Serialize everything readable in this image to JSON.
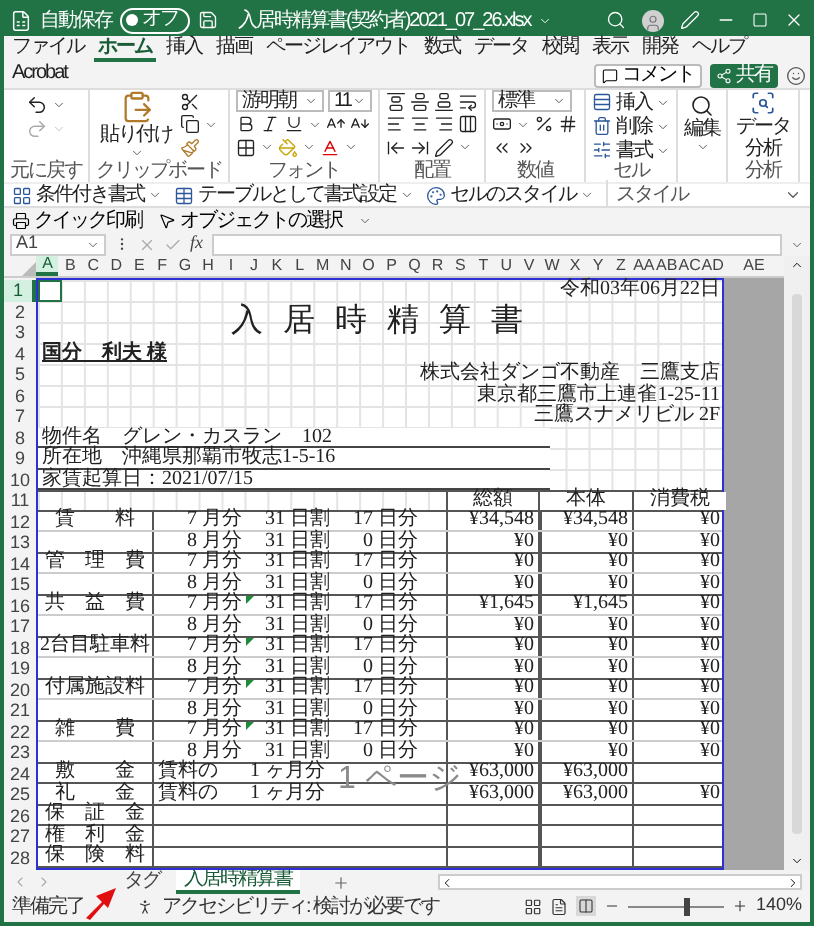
{
  "title_bar": {
    "autosave_label": "自動保存",
    "autosave": {
      "label": "オフ",
      "on": false
    },
    "filename": "入居時精算書(契約者)2021_07_26.xlsx"
  },
  "menu": {
    "tabs": [
      {
        "label": "ファイル",
        "selected": false
      },
      {
        "label": "ホーム",
        "selected": true
      },
      {
        "label": "挿入",
        "selected": false
      },
      {
        "label": "描画",
        "selected": false
      },
      {
        "label": "ページレイアウト",
        "selected": false
      },
      {
        "label": "数式",
        "selected": false
      },
      {
        "label": "データ",
        "selected": false
      },
      {
        "label": "校閲",
        "selected": false
      },
      {
        "label": "表示",
        "selected": false
      },
      {
        "label": "開発",
        "selected": false
      },
      {
        "label": "ヘルプ",
        "selected": false
      },
      {
        "label": "Acrobat",
        "selected": false
      }
    ],
    "comment_button": "コメント",
    "share_button": "共有"
  },
  "ribbon": {
    "groups": [
      {
        "kind": "undo",
        "label": "元に戻す"
      },
      {
        "kind": "clipboard",
        "label": "クリップボード",
        "paste": "貼り付け"
      },
      {
        "kind": "font",
        "label": "フォント",
        "font_name": "游明朝",
        "font_size": "11"
      },
      {
        "kind": "alignment",
        "label": "配置"
      },
      {
        "kind": "number",
        "label": "数値",
        "format": "標準"
      },
      {
        "kind": "cells",
        "label": "セル",
        "items": [
          "挿入",
          "削除",
          "書式"
        ]
      },
      {
        "kind": "editing",
        "button": "編集"
      },
      {
        "kind": "analysis",
        "label": "分析",
        "button": "データ分析"
      }
    ],
    "styles": {
      "label": "スタイル",
      "items": [
        "条件付き書式",
        "テーブルとして書式設定",
        "セルのスタイル"
      ]
    }
  },
  "quick_access": {
    "items": [
      "クイック印刷",
      "オブジェクトの選択"
    ]
  },
  "formula_bar": {
    "name_box": "A1",
    "fx": "fx"
  },
  "sheet": {
    "columns": [
      {
        "label": "A",
        "selected": true
      },
      {
        "label": "B",
        "selected": false
      },
      {
        "label": "C",
        "selected": false
      },
      {
        "label": "D",
        "selected": false
      },
      {
        "label": "E",
        "selected": false
      },
      {
        "label": "F",
        "selected": false
      },
      {
        "label": "G",
        "selected": false
      },
      {
        "label": "H",
        "selected": false
      },
      {
        "label": "I",
        "selected": false
      },
      {
        "label": "J",
        "selected": false
      },
      {
        "label": "K",
        "selected": false
      },
      {
        "label": "L",
        "selected": false
      },
      {
        "label": "M",
        "selected": false
      },
      {
        "label": "N",
        "selected": false
      },
      {
        "label": "O",
        "selected": false
      },
      {
        "label": "P",
        "selected": false
      },
      {
        "label": "Q",
        "selected": false
      },
      {
        "label": "R",
        "selected": false
      },
      {
        "label": "S",
        "selected": false
      },
      {
        "label": "T",
        "selected": false
      },
      {
        "label": "U",
        "selected": false
      },
      {
        "label": "V",
        "selected": false
      },
      {
        "label": "W",
        "selected": false
      },
      {
        "label": "X",
        "selected": false
      },
      {
        "label": "Y",
        "selected": false
      },
      {
        "label": "Z",
        "selected": false
      },
      {
        "label": "AA",
        "selected": false
      },
      {
        "label": "AB",
        "selected": false
      },
      {
        "label": "AC",
        "selected": false
      },
      {
        "label": "AD",
        "selected": false
      }
    ],
    "outside_column": "AE",
    "row_numbers": [
      {
        "label": "1",
        "selected": true
      },
      {
        "label": "2",
        "selected": false
      },
      {
        "label": "3",
        "selected": false
      },
      {
        "label": "4",
        "selected": false
      },
      {
        "label": "5",
        "selected": false
      },
      {
        "label": "6",
        "selected": false
      },
      {
        "label": "7",
        "selected": false
      },
      {
        "label": "8",
        "selected": false
      },
      {
        "label": "9",
        "selected": false
      },
      {
        "label": "10",
        "selected": false
      },
      {
        "label": "11",
        "selected": false
      },
      {
        "label": "12",
        "selected": false
      },
      {
        "label": "13",
        "selected": false
      },
      {
        "label": "14",
        "selected": false
      },
      {
        "label": "15",
        "selected": false
      },
      {
        "label": "16",
        "selected": false
      },
      {
        "label": "17",
        "selected": false
      },
      {
        "label": "18",
        "selected": false
      },
      {
        "label": "19",
        "selected": false
      },
      {
        "label": "20",
        "selected": false
      },
      {
        "label": "21",
        "selected": false
      },
      {
        "label": "22",
        "selected": false
      },
      {
        "label": "23",
        "selected": false
      },
      {
        "label": "24",
        "selected": false
      },
      {
        "label": "25",
        "selected": false
      },
      {
        "label": "26",
        "selected": false
      },
      {
        "label": "27",
        "selected": false
      },
      {
        "label": "28",
        "selected": false
      }
    ],
    "document": {
      "date": "令和03年06月22日",
      "title": "入 居 時 精 算 書",
      "addressee": "国分　利夫 様",
      "company_lines": [
        "株式会社ダンゴ不動産　三鷹支店",
        "東京都三鷹市上連雀1-25-11",
        "三鷹スナメリビル 2F"
      ],
      "info_lines": [
        "物件名　グレン・カスラン　102",
        "所在地　沖縄県那覇市牧志1-5-16",
        "家賃起算日：2021/07/15"
      ],
      "headers": [
        "総額",
        "本体",
        "消費税"
      ],
      "charges": [
        {
          "label": "賃　　料",
          "lines": [
            {
              "month": "7 月分",
              "split": "31 日割",
              "days": "17 日分",
              "total": "¥34,548",
              "body": "¥34,548",
              "tax": "¥0",
              "flag": false
            },
            {
              "month": "8 月分",
              "split": "31 日割",
              "days": "0 日分",
              "total": "¥0",
              "body": "¥0",
              "tax": "¥0",
              "flag": false
            }
          ]
        },
        {
          "label": "管　理　費",
          "lines": [
            {
              "month": "7 月分",
              "split": "31 日割",
              "days": "17 日分",
              "total": "¥0",
              "body": "¥0",
              "tax": "¥0",
              "flag": false
            },
            {
              "month": "8 月分",
              "split": "31 日割",
              "days": "0 日分",
              "total": "¥0",
              "body": "¥0",
              "tax": "¥0",
              "flag": false
            }
          ]
        },
        {
          "label": "共　益　費",
          "lines": [
            {
              "month": "7 月分",
              "split": "31 日割",
              "days": "17 日分",
              "total": "¥1,645",
              "body": "¥1,645",
              "tax": "¥0",
              "flag": true
            },
            {
              "month": "8 月分",
              "split": "31 日割",
              "days": "0 日分",
              "total": "¥0",
              "body": "¥0",
              "tax": "¥0",
              "flag": false
            }
          ]
        },
        {
          "label": "2台目駐車料",
          "lines": [
            {
              "month": "7 月分",
              "split": "31 日割",
              "days": "17 日分",
              "total": "¥0",
              "body": "¥0",
              "tax": "¥0",
              "flag": true
            },
            {
              "month": "8 月分",
              "split": "31 日割",
              "days": "0 日分",
              "total": "¥0",
              "body": "¥0",
              "tax": "¥0",
              "flag": false
            }
          ]
        },
        {
          "label": "付属施設料",
          "lines": [
            {
              "month": "7 月分",
              "split": "31 日割",
              "days": "17 日分",
              "total": "¥0",
              "body": "¥0",
              "tax": "¥0",
              "flag": true
            },
            {
              "month": "8 月分",
              "split": "31 日割",
              "days": "0 日分",
              "total": "¥0",
              "body": "¥0",
              "tax": "¥0",
              "flag": false
            }
          ]
        },
        {
          "label": "雑　　費",
          "lines": [
            {
              "month": "7 月分",
              "split": "31 日割",
              "days": "17 日分",
              "total": "¥0",
              "body": "¥0",
              "tax": "¥0",
              "flag": true
            },
            {
              "month": "8 月分",
              "split": "31 日割",
              "days": "0 日分",
              "total": "¥0",
              "body": "¥0",
              "tax": "¥0",
              "flag": false
            }
          ]
        }
      ],
      "deposits": [
        {
          "label": "敷　　金",
          "basis": "賃料の",
          "months": "1 ヶ月分",
          "total": "¥63,000",
          "body": "¥63,000"
        },
        {
          "label": "礼　　金",
          "basis": "賃料の",
          "months": "1 ヶ月分",
          "total": "¥63,000",
          "body": "¥63,000",
          "tax": "¥0"
        }
      ],
      "other_items": [
        "保　証　金",
        "権　利　金",
        "保　険　料"
      ],
      "page_label": "1 ページ"
    },
    "tabs": [
      {
        "label": "タグ",
        "selected": false
      },
      {
        "label": "入居時精算書",
        "selected": true
      }
    ]
  },
  "status_bar": {
    "ready": "準備完了",
    "accessibility": "アクセシビリティ: 検討が必要です",
    "zoom_slider": {
      "level": 0.62
    },
    "zoom": "140%"
  }
}
